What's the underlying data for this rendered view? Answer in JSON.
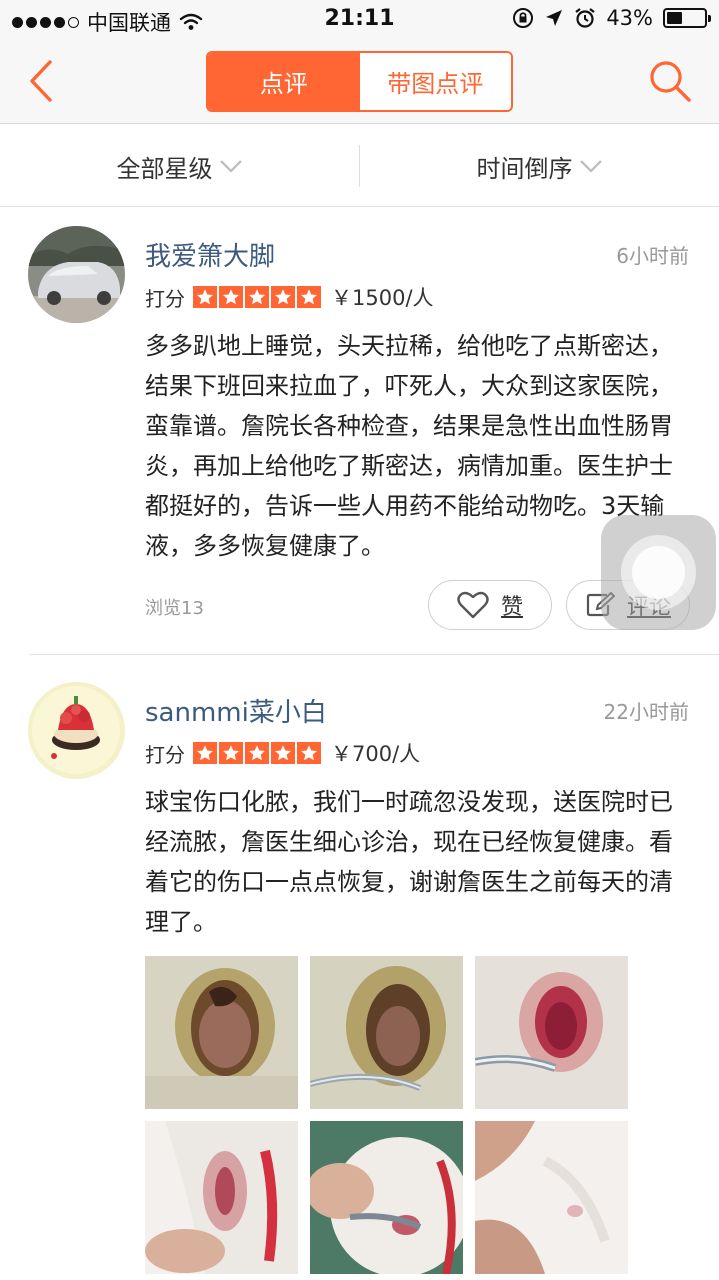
{
  "status_bar": {
    "signal_dots": 5,
    "carrier": "中国联通",
    "time": "21:11",
    "battery_text": "43%",
    "battery_level": 0.43
  },
  "nav": {
    "back_icon": "chevron-left-icon",
    "search_icon": "search-icon",
    "tabs": [
      {
        "label": "点评",
        "active": true
      },
      {
        "label": "带图点评",
        "active": false
      }
    ],
    "accent": "#ff6633"
  },
  "filters": {
    "rating_filter": "全部星级",
    "sort_filter": "时间倒序"
  },
  "reviews": [
    {
      "user": "我爱箫大脚",
      "time": "6小时前",
      "rating_label": "打分",
      "stars": 5,
      "price": "￥1500/人",
      "text": "多多趴地上睡觉，头天拉稀，给他吃了点斯密达，结果下班回来拉血了，吓死人，大众到这家医院，蛮靠谱。詹院长各种检查，结果是急性出血性肠胃炎，再加上给他吃了斯密达，病情加重。医生护士都挺好的，告诉一些人用药不能给动物吃。3天输液，多多恢复健康了。",
      "views": "浏览13",
      "like_label": "赞",
      "comment_label": "评论"
    },
    {
      "user": "sanmmi菜小白",
      "time": "22小时前",
      "rating_label": "打分",
      "stars": 5,
      "price": "￥700/人",
      "text": "球宝伤口化脓，我们一时疏忽没发现，送医院时已经流脓，詹医生细心诊治，现在已经恢复健康。看着它的伤口一点点恢复，谢谢詹医生之前每天的清理了。",
      "photo_count": 6
    }
  ],
  "colors": {
    "username": "#3d5a80",
    "star_bg": "#ff6633",
    "muted": "#999999"
  }
}
